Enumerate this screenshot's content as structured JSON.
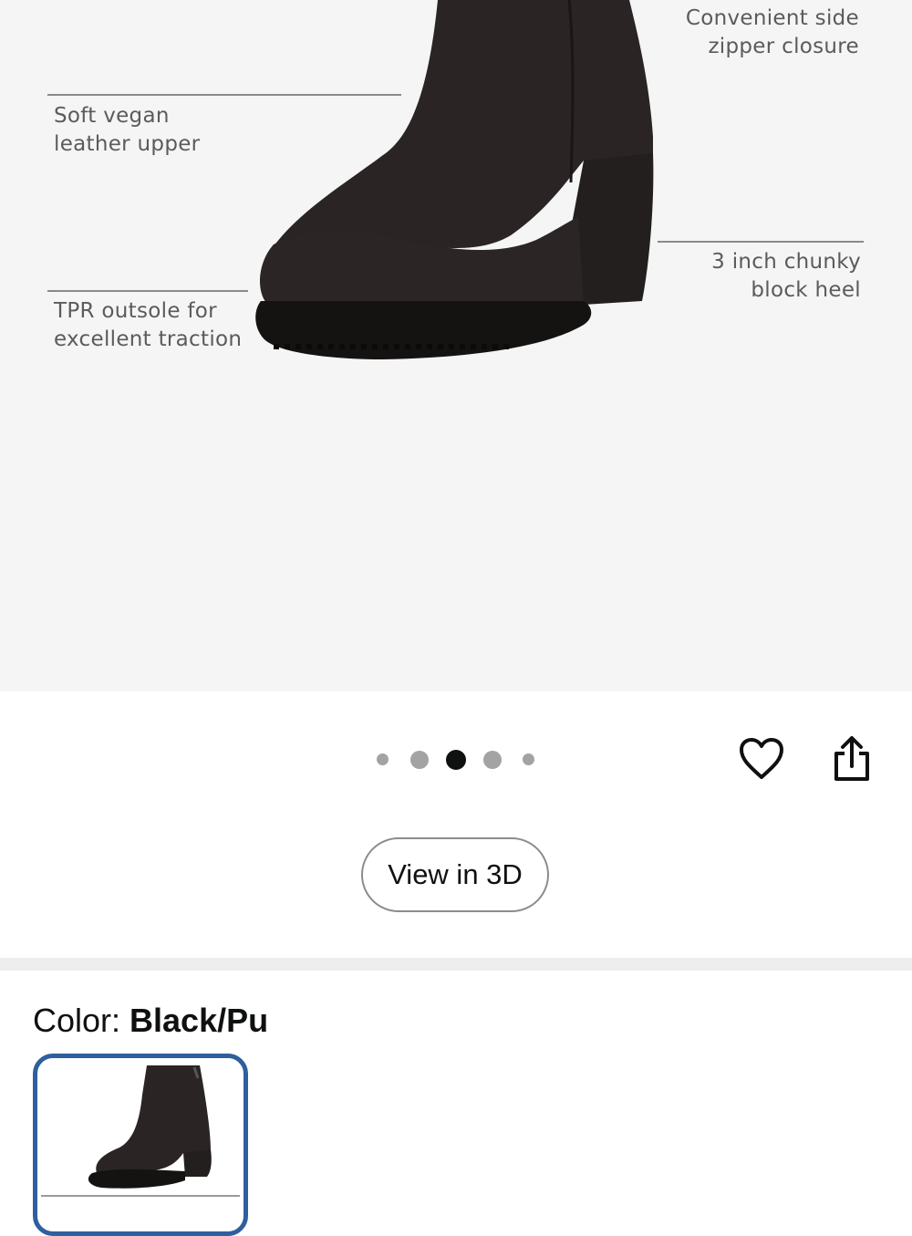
{
  "hero": {
    "callouts": {
      "zipper": "Convenient side\nzipper closure",
      "upper": "Soft vegan\nleather upper",
      "heel": "3 inch chunky\nblock heel",
      "outsole": "TPR outsole for\nexcellent traction"
    }
  },
  "carousel": {
    "page_count": 5,
    "active_index": 2
  },
  "actions": {
    "favorite_icon": "heart-outline-icon",
    "share_icon": "share-icon"
  },
  "view_3d": {
    "label": "View in 3D"
  },
  "color": {
    "label": "Color: ",
    "selected": "Black/Pu",
    "accent": "#2e5f9e"
  }
}
